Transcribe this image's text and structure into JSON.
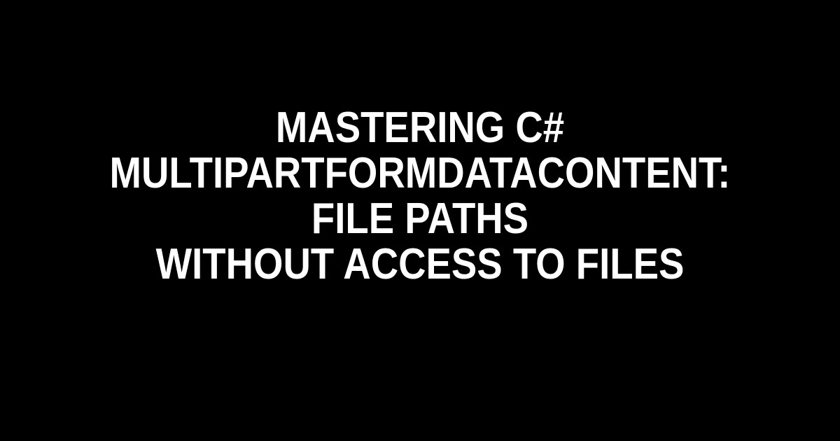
{
  "title_lines": {
    "line1": "Mastering C#",
    "line2": "MultipartFormDataContent: File Paths",
    "line3": "Without Access to Files"
  }
}
